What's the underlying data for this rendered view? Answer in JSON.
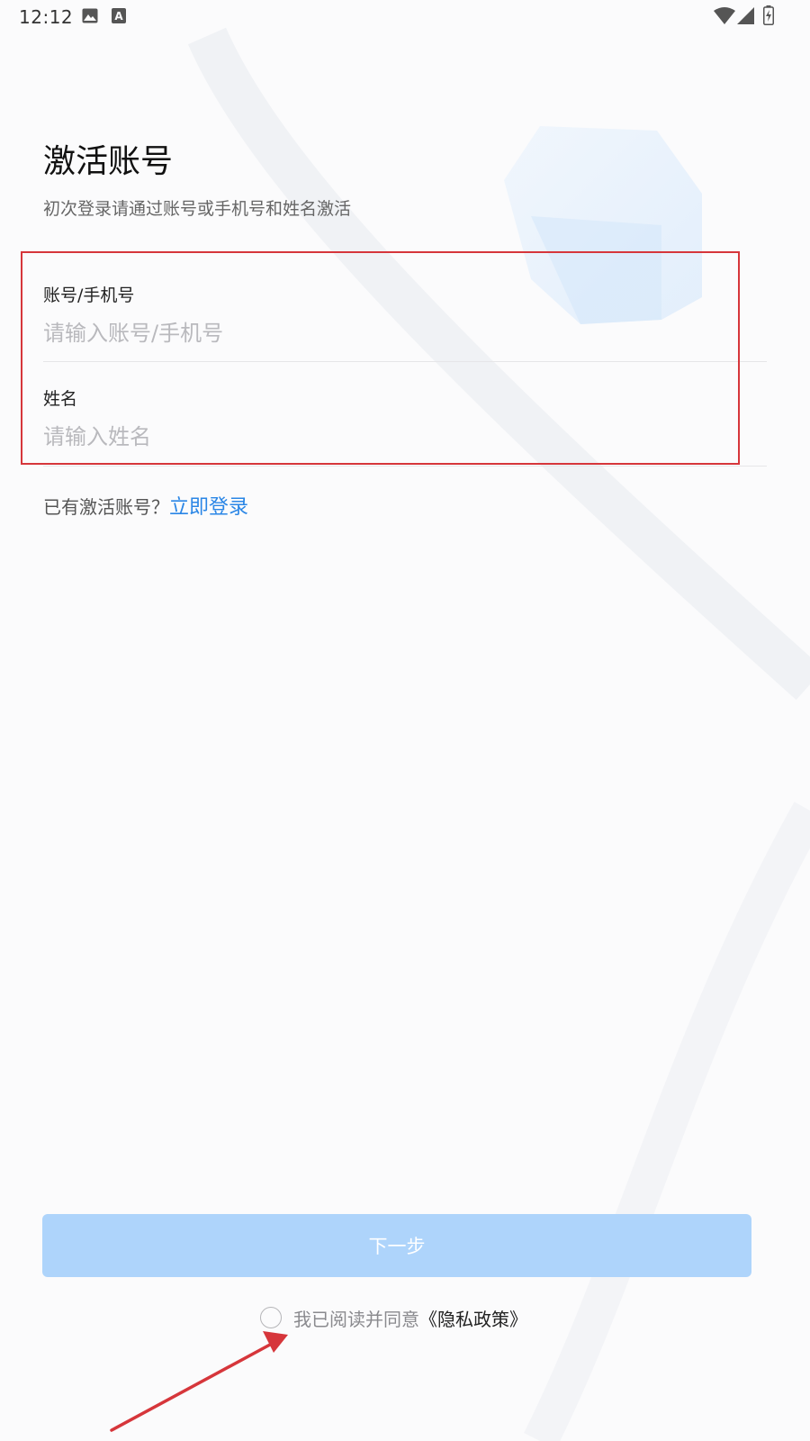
{
  "status_bar": {
    "time": "12:12",
    "left_icons": [
      "image-icon",
      "font-a-icon"
    ],
    "right_icons": [
      "wifi-icon",
      "signal-icon",
      "battery-charging-icon"
    ]
  },
  "header": {
    "title": "激活账号",
    "subtitle": "初次登录请通过账号或手机号和姓名激活"
  },
  "form": {
    "account": {
      "label": "账号/手机号",
      "placeholder": "请输入账号/手机号",
      "value": ""
    },
    "name": {
      "label": "姓名",
      "placeholder": "请输入姓名",
      "value": ""
    }
  },
  "login_prompt": {
    "text": "已有激活账号？",
    "link": "立即登录"
  },
  "next_button": {
    "label": "下一步"
  },
  "agreement": {
    "checked": false,
    "text": "我已阅读并同意",
    "policy_link": "《隐私政策》"
  },
  "colors": {
    "accent": "#2a86e6",
    "button_disabled": "#aed4fb",
    "annotation_red": "#d6363b"
  }
}
